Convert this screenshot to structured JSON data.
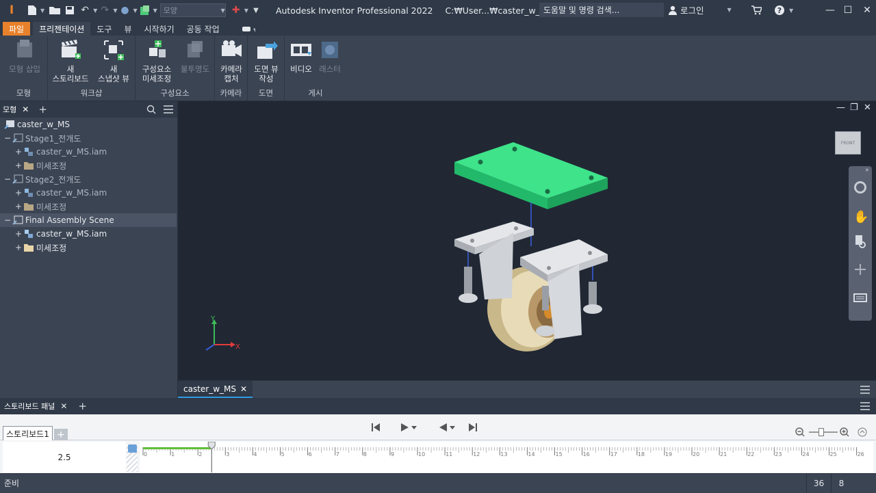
{
  "titlebar": {
    "appearance_placeholder": "모양",
    "app_title": "Autodesk Inventor Professional 2022",
    "file_path": "C:₩User...₩caster_w_MS",
    "search_placeholder": "도움말 및 명령 검색...",
    "login_label": "로그인"
  },
  "ribbon_tabs": [
    {
      "label": "파일"
    },
    {
      "label": "프리젠테이션"
    },
    {
      "label": "도구"
    },
    {
      "label": "뷰"
    },
    {
      "label": "시작하기"
    },
    {
      "label": "공동 작업"
    }
  ],
  "ribbon_groups": {
    "model": {
      "label": "모형",
      "buttons": [
        {
          "label": "모형 삽입"
        }
      ]
    },
    "workshop": {
      "label": "워크샵",
      "buttons": [
        {
          "label": "새\n스토리보드"
        },
        {
          "label": "새\n스냅샷 뷰"
        }
      ]
    },
    "components": {
      "label": "구성요소",
      "buttons": [
        {
          "label": "구성요소\n미세조정"
        },
        {
          "label": "불투명도"
        }
      ]
    },
    "camera": {
      "label": "카메라",
      "buttons": [
        {
          "label": "카메라\n캡처"
        }
      ]
    },
    "drawing": {
      "label": "도면",
      "buttons": [
        {
          "label": "도면 뷰\n작성"
        }
      ]
    },
    "publish": {
      "label": "게시",
      "buttons": [
        {
          "label": "비디오"
        },
        {
          "label": "래스터"
        }
      ]
    }
  },
  "browser": {
    "tab_label": "모형",
    "tree": [
      {
        "label": "caster_w_MS"
      },
      {
        "label": "Stage1_전개도"
      },
      {
        "label": "caster_w_MS.iam"
      },
      {
        "label": "미세조정"
      },
      {
        "label": "Stage2_전개도"
      },
      {
        "label": "caster_w_MS.iam"
      },
      {
        "label": "미세조정"
      },
      {
        "label": "Final Assembly Scene"
      },
      {
        "label": "caster_w_MS.iam"
      },
      {
        "label": "미세조정"
      }
    ]
  },
  "viewport": {
    "viewcube_label": "FRONT",
    "axis_x": "X",
    "axis_y": "Y"
  },
  "document_tab": {
    "label": "caster_w_MS"
  },
  "storyboard": {
    "panel_title": "스토리보드 패널",
    "tab_label": "스토리보드1",
    "current_time": "2.5",
    "playhead_seconds": 2.5,
    "timeline_ticks": [
      "0",
      "1",
      "2",
      "3",
      "4",
      "5",
      "6",
      "7",
      "8",
      "9",
      "10",
      "11",
      "12",
      "13",
      "14",
      "15",
      "16",
      "17",
      "18",
      "19",
      "20",
      "21",
      "22",
      "23",
      "24",
      "25",
      "26"
    ]
  },
  "status": {
    "text": "준비",
    "count_a": "36",
    "count_b": "8"
  },
  "colors": {
    "accent_file_tab": "#e8812b",
    "selected_part": "#3ee38a",
    "active_tab_underline": "#2f9be0"
  }
}
